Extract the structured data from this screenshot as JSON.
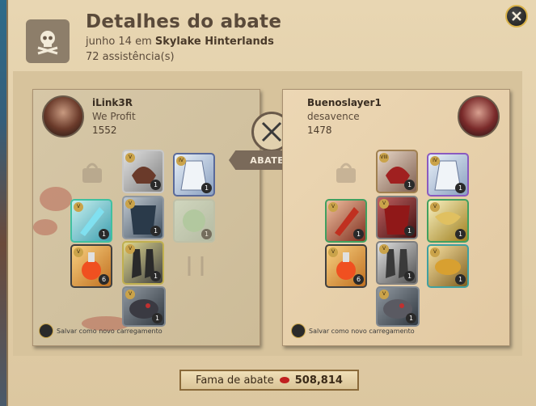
{
  "header": {
    "title": "Detalhes do abate",
    "date": "junho 14 em",
    "location": "Skylake Hinterlands",
    "assists": "72 assistência(s)"
  },
  "killer": {
    "name": "iLink3R",
    "guild": "We Profit",
    "item_power": "1552",
    "save_label": "Salvar como novo carregamento",
    "slots": [
      {
        "name": "bag",
        "empty": true
      },
      {
        "name": "helmet",
        "tier": "V",
        "badge": "1",
        "color": "#b8b8b8"
      },
      {
        "name": "cape",
        "tier": "IV",
        "badge": "1",
        "color": "#c8d8e8"
      },
      {
        "name": "weapon",
        "tier": "V",
        "badge": "1",
        "color": "#7ad0e0"
      },
      {
        "name": "armor",
        "tier": "V",
        "badge": "1",
        "color": "#707070"
      },
      {
        "name": "offhand",
        "tier": "V",
        "badge": "1",
        "color": "#9ad0a0"
      },
      {
        "name": "potion",
        "tier": "V",
        "badge": "6",
        "color": "#e8a040"
      },
      {
        "name": "boots",
        "tier": "V",
        "badge": "1",
        "color": "#404040"
      },
      {
        "name": "food",
        "empty": true
      },
      {
        "name": "mount",
        "tier": "V",
        "badge": "1",
        "color": "#606060"
      }
    ]
  },
  "victim": {
    "name": "Buenoslayer1",
    "guild": "desavence",
    "item_power": "1478",
    "save_label": "Salvar como novo carregamento",
    "slots": [
      {
        "name": "bag",
        "empty": true
      },
      {
        "name": "helmet",
        "tier": "VIII",
        "badge": "1",
        "color": "#a02020"
      },
      {
        "name": "cape",
        "tier": "IV",
        "badge": "1",
        "color": "#c8d8e8"
      },
      {
        "name": "weapon",
        "tier": "V",
        "badge": "1",
        "color": "#d04020"
      },
      {
        "name": "armor",
        "tier": "V",
        "badge": "1",
        "color": "#901818"
      },
      {
        "name": "offhand",
        "tier": "V",
        "badge": "1",
        "color": "#e0c060"
      },
      {
        "name": "potion",
        "tier": "V",
        "badge": "6",
        "color": "#e8a040"
      },
      {
        "name": "boots",
        "tier": "V",
        "badge": "1",
        "color": "#505050"
      },
      {
        "name": "food",
        "tier": "V",
        "badge": "1",
        "color": "#d8a030"
      },
      {
        "name": "mount",
        "tier": "V",
        "badge": "1",
        "color": "#707070"
      }
    ]
  },
  "versus": {
    "label": "ABATEU"
  },
  "fame": {
    "label": "Fama de abate",
    "value": "508,814"
  },
  "colors": {
    "accent": "#d9b24a",
    "parchment": "#e8d6b2",
    "text": "#5a4a3a"
  }
}
